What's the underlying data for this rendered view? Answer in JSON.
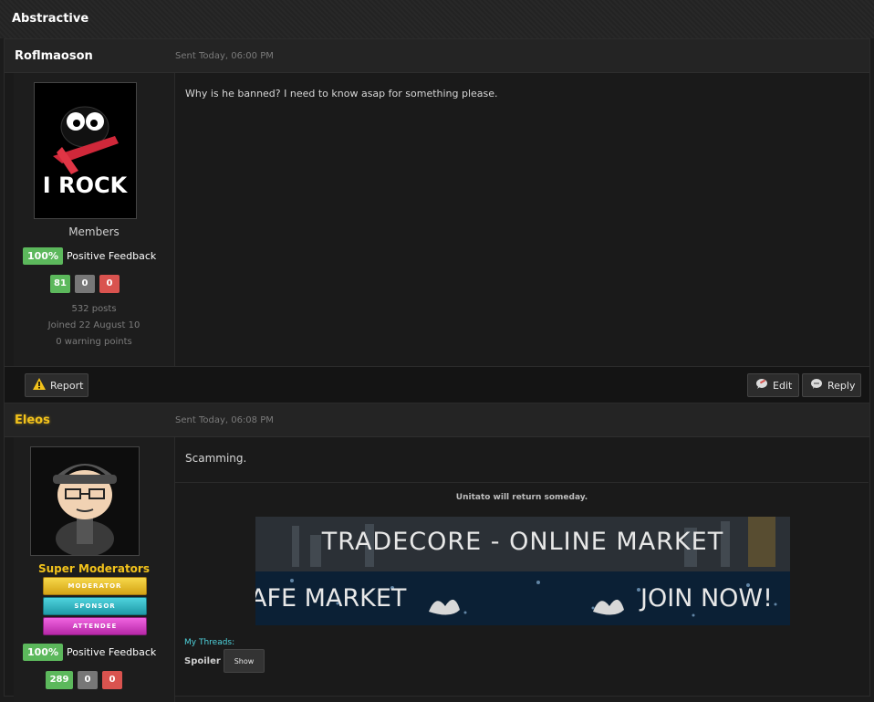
{
  "topbar": {
    "title": "Abstractive"
  },
  "posts": [
    {
      "author": "Roflmaoson",
      "author_color": "#ffffff",
      "date": "Sent Today, 06:00 PM",
      "avatar_text": "I ROCK",
      "group": "Members",
      "group_color": "#d0d0d0",
      "feedback_pct": "100%",
      "feedback_label": "Positive Feedback",
      "rep": [
        "81",
        "0",
        "0"
      ],
      "posts": "532 posts",
      "joined": "Joined 22 August 10",
      "warnings": "0 warning points",
      "message": "Why is he banned? I need to know asap for something please.",
      "buttons": {
        "report": "Report",
        "edit": "Edit",
        "reply": "Reply"
      }
    },
    {
      "author": "Eleos",
      "author_color": "#f2c21b",
      "date": "Sent Today, 06:08 PM",
      "group": "Super Moderators",
      "group_color": "#f2c21b",
      "badges": [
        "MODERATOR",
        "SPONSOR",
        "ATTENDEE"
      ],
      "feedback_pct": "100%",
      "feedback_label": "Positive Feedback",
      "rep": [
        "289",
        "0",
        "0"
      ],
      "message": "Scamming.",
      "signature": {
        "line": "Unitato will return someday.",
        "banner_top": "TRADECORE - ONLINE MARKET",
        "banner_left": "AFE MARKET",
        "banner_right": "JOIN NOW!",
        "my_threads": "My Threads:",
        "spoiler": "Spoiler",
        "show": "Show"
      }
    }
  ]
}
